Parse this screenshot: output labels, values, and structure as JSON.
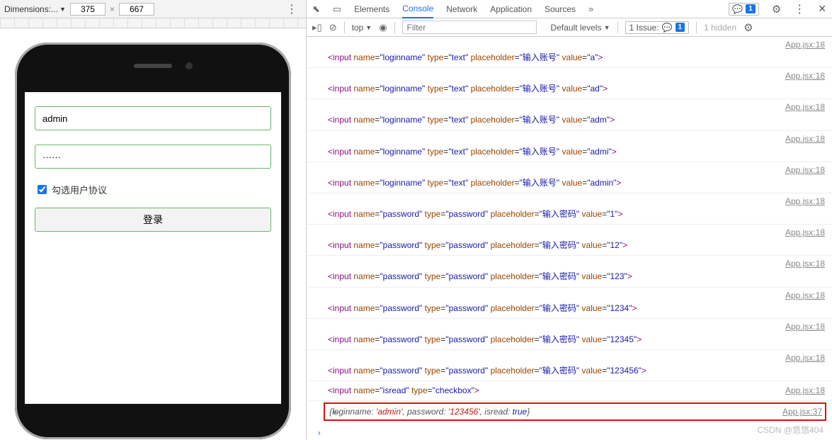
{
  "dimbar": {
    "label": "Dimensions:...",
    "w": "375",
    "h": "667"
  },
  "form": {
    "login_value": "admin",
    "login_placeholder": "输入账号",
    "pwd_value": "······",
    "pwd_placeholder": "输入密码",
    "agree_label": "勾选用户协议",
    "login_btn": "登录"
  },
  "tabs": {
    "elements": "Elements",
    "console": "Console",
    "network": "Network",
    "application": "Application",
    "sources": "Sources",
    "msg_count": "1"
  },
  "subbar": {
    "context": "top",
    "filter_ph": "Filter",
    "levels": "Default levels",
    "issues_label": "1 Issue:",
    "issues_count": "1",
    "hidden": "1 hidden"
  },
  "src1": "App.jsx:18",
  "src2": "App.jsx:37",
  "logs": [
    {
      "name": "loginname",
      "type": "text",
      "ph": "输入账号",
      "val": "a"
    },
    {
      "name": "loginname",
      "type": "text",
      "ph": "输入账号",
      "val": "ad"
    },
    {
      "name": "loginname",
      "type": "text",
      "ph": "输入账号",
      "val": "adm"
    },
    {
      "name": "loginname",
      "type": "text",
      "ph": "输入账号",
      "val": "admi"
    },
    {
      "name": "loginname",
      "type": "text",
      "ph": "输入账号",
      "val": "admin"
    },
    {
      "name": "password",
      "type": "password",
      "ph": "输入密码",
      "val": "1"
    },
    {
      "name": "password",
      "type": "password",
      "ph": "输入密码",
      "val": "12"
    },
    {
      "name": "password",
      "type": "password",
      "ph": "输入密码",
      "val": "123"
    },
    {
      "name": "password",
      "type": "password",
      "ph": "输入密码",
      "val": "1234"
    },
    {
      "name": "password",
      "type": "password",
      "ph": "输入密码",
      "val": "12345"
    },
    {
      "name": "password",
      "type": "password",
      "ph": "输入密码",
      "val": "123456"
    }
  ],
  "chk_log": {
    "name": "isread",
    "type": "checkbox"
  },
  "obj": {
    "loginname": "admin",
    "password": "123456",
    "isread": "true"
  },
  "watermark": "CSDN @悠悠404"
}
